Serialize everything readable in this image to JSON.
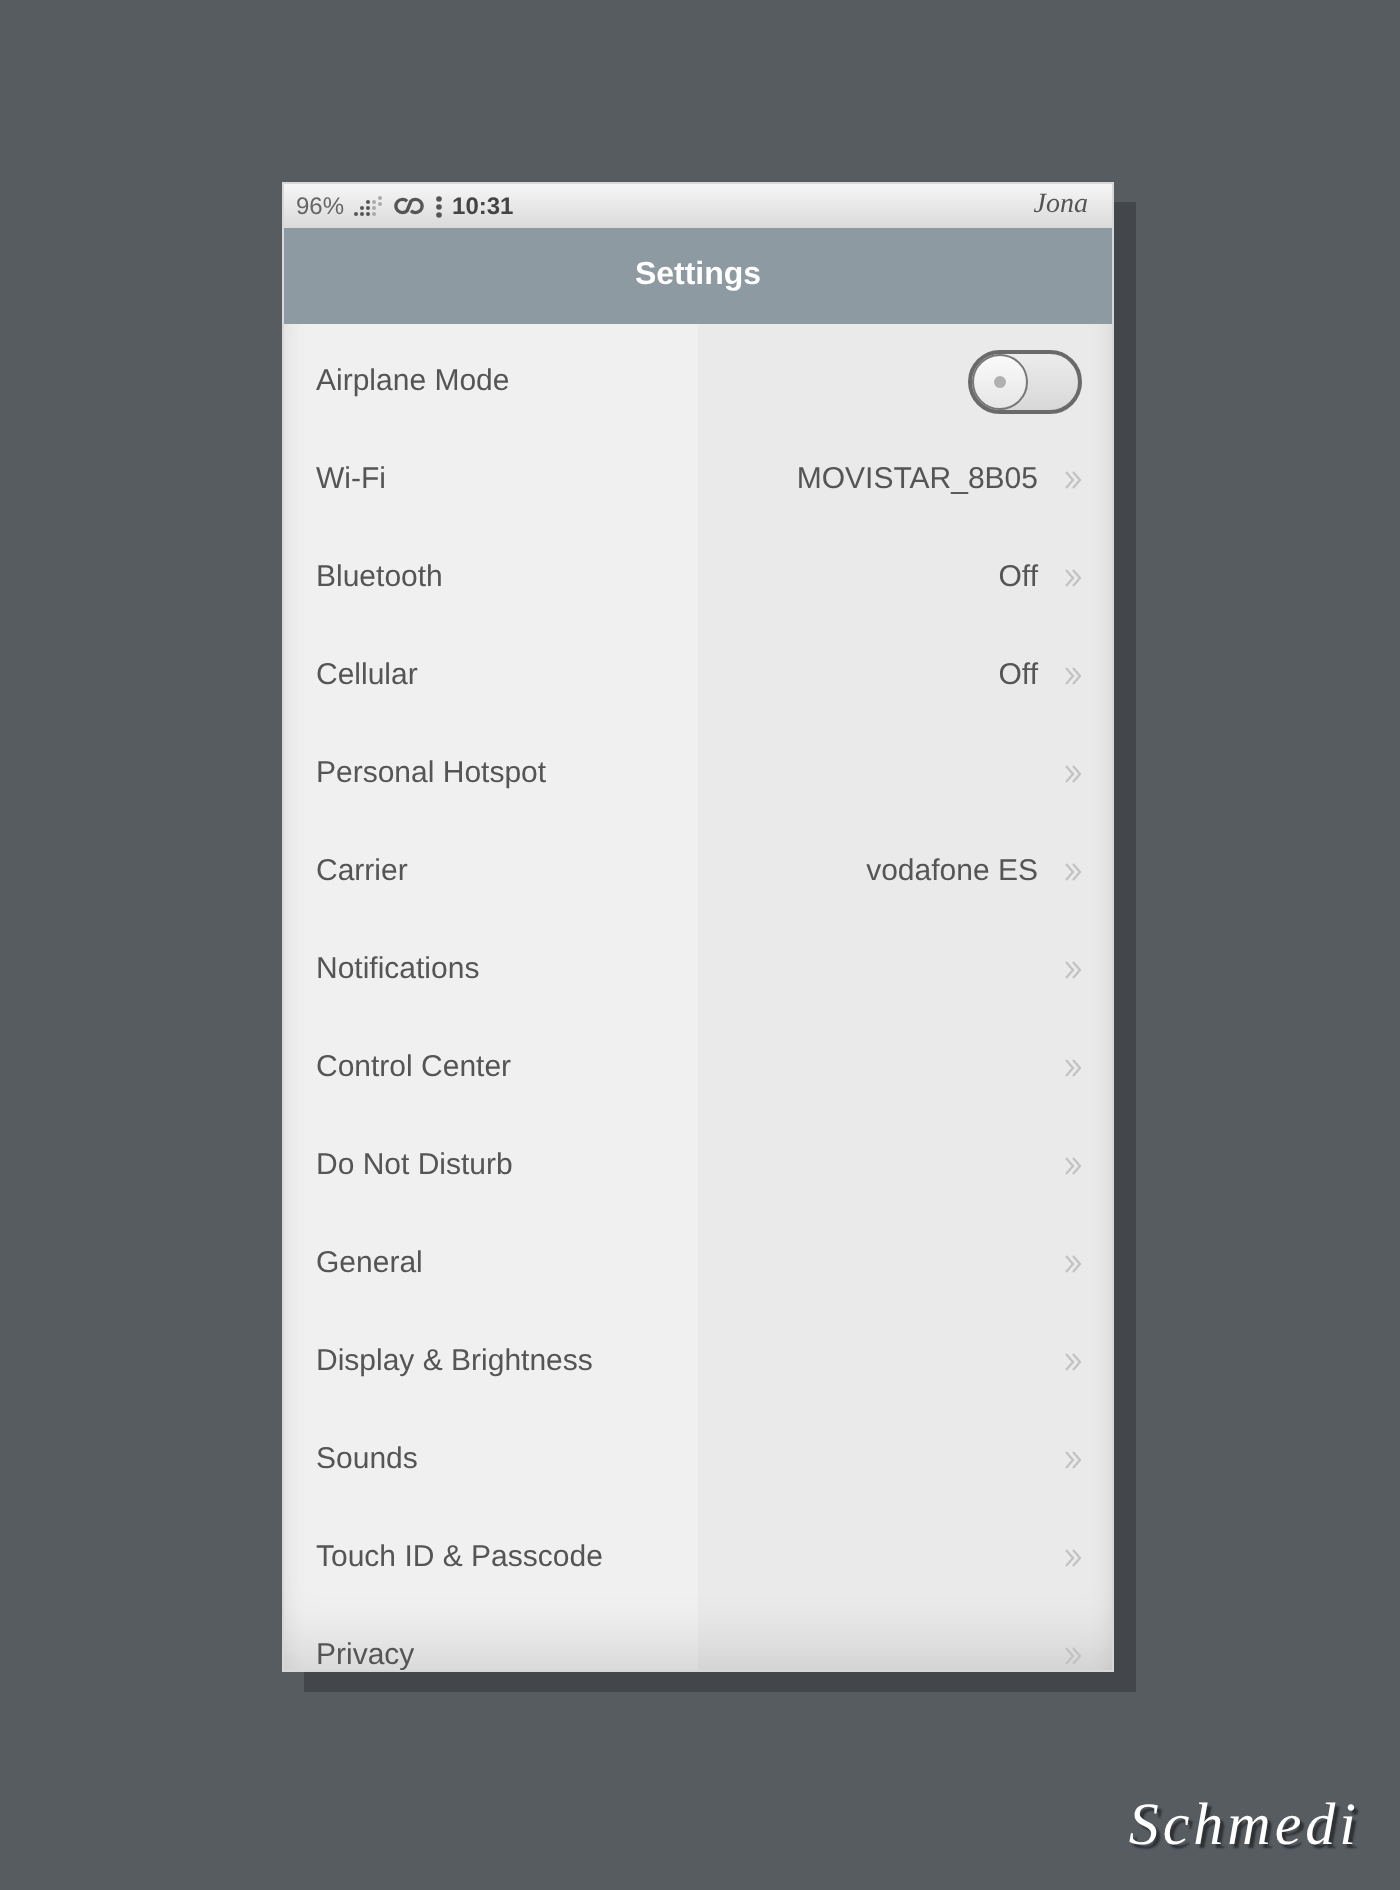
{
  "status_bar": {
    "battery": "96%",
    "time": "10:31",
    "user": "Jona"
  },
  "header": {
    "title": "Settings"
  },
  "items": [
    {
      "kind": "toggle",
      "label": "Airplane Mode",
      "on": false
    },
    {
      "kind": "link",
      "label": "Wi-Fi",
      "value": "MOVISTAR_8B05"
    },
    {
      "kind": "link",
      "label": "Bluetooth",
      "value": "Off"
    },
    {
      "kind": "link",
      "label": "Cellular",
      "value": "Off"
    },
    {
      "kind": "link",
      "label": "Personal Hotspot"
    },
    {
      "kind": "link",
      "label": "Carrier",
      "value": "vodafone ES"
    },
    {
      "kind": "link",
      "label": "Notifications"
    },
    {
      "kind": "link",
      "label": "Control Center"
    },
    {
      "kind": "link",
      "label": "Do Not Disturb"
    },
    {
      "kind": "link",
      "label": "General"
    },
    {
      "kind": "link",
      "label": "Display & Brightness"
    },
    {
      "kind": "link",
      "label": "Sounds"
    },
    {
      "kind": "link",
      "label": "Touch ID & Passcode"
    },
    {
      "kind": "link",
      "label": "Privacy"
    }
  ],
  "signature": "Schmedi"
}
